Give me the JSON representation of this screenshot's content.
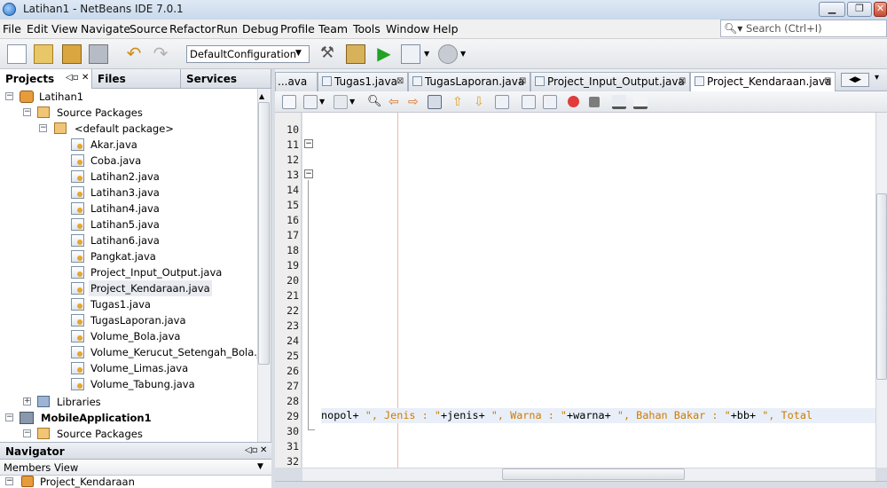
{
  "window": {
    "title": "Latihan1 - NetBeans IDE 7.0.1"
  },
  "menubar": {
    "items": [
      "File",
      "Edit",
      "View",
      "Navigate",
      "Source",
      "Refactor",
      "Run",
      "Debug",
      "Profile",
      "Team",
      "Tools",
      "Window",
      "Help"
    ]
  },
  "search": {
    "placeholder": "Search (Ctrl+I)"
  },
  "toolbar": {
    "configuration": "DefaultConfiguration"
  },
  "left_panel": {
    "tabs": [
      "Projects",
      "Files",
      "Services"
    ],
    "tree": {
      "project": "Latihan1",
      "source_packages": "Source Packages",
      "default_package": "<default package>",
      "files": [
        "Akar.java",
        "Coba.java",
        "Latihan2.java",
        "Latihan3.java",
        "Latihan4.java",
        "Latihan5.java",
        "Latihan6.java",
        "Pangkat.java",
        "Project_Input_Output.java",
        "Project_Kendaraan.java",
        "Tugas1.java",
        "TugasLaporan.java",
        "Volume_Bola.java",
        "Volume_Kerucut_Setengah_Bola.java",
        "Volume_Limas.java",
        "Volume_Tabung.java"
      ],
      "selected_file": "Project_Kendaraan.java",
      "libraries": "Libraries",
      "project2": "MobileApplication1",
      "project2_source": "Source Packages"
    }
  },
  "navigator": {
    "title": "Navigator",
    "view": "Members View",
    "item": "Project_Kendaraan"
  },
  "editor": {
    "tabs": [
      "...ava",
      "Tugas1.java",
      "TugasLaporan.java",
      "Project_Input_Output.java",
      "Project_Kendaraan.java"
    ],
    "active_tab": "Project_Kendaraan.java",
    "line_numbers": [
      "10",
      "11",
      "12",
      "13",
      "14",
      "15",
      "16",
      "17",
      "18",
      "19",
      "20",
      "21",
      "22",
      "23",
      "24",
      "25",
      "26",
      "27",
      "28",
      "29",
      "30",
      "31",
      "32"
    ],
    "code_line_29": {
      "seg1": "nopol+ ",
      "seg2": "\", Jenis : \"",
      "seg3": "+jenis+ ",
      "seg4": "\", Warna : \"",
      "seg5": "+warna+ ",
      "seg6": "\", Bahan Bakar : \"",
      "seg7": "+bb+ ",
      "seg8": "\", Total"
    }
  },
  "colors": {
    "string": "#ce7b00",
    "selection": "#e8ebef",
    "current_line": "#e9eff8"
  }
}
